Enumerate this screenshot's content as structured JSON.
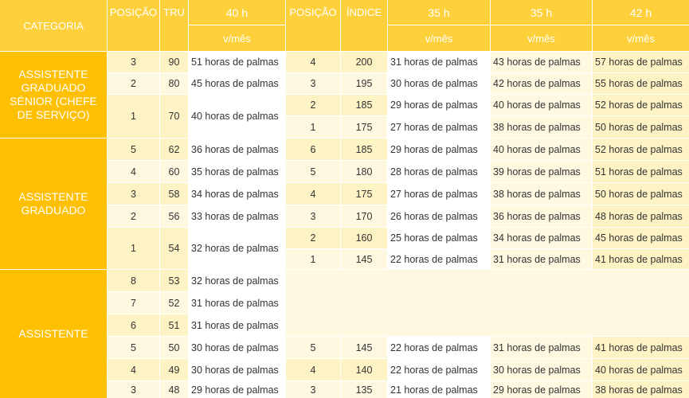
{
  "headers": {
    "categoria": "CATEGORIA",
    "posicao": "POSIÇÃO",
    "tru": "TRU",
    "h40": "40 h",
    "posicao2": "POSIÇÃO",
    "indice": "ÍNDICE",
    "h35a": "35 h",
    "h35b": "35 h",
    "h42": "42 h",
    "sub": "v/mês"
  },
  "categories": [
    {
      "label": "ASSISTENTE GRADUADO SÉNIOR (CHEFE DE SERVIÇO)"
    },
    {
      "label": "ASSISTENTE GRADUADO"
    },
    {
      "label": "ASSISTENTE"
    }
  ],
  "left_rows": [
    {
      "posicao": "3",
      "tru": "90",
      "h40": "51 horas de palmas"
    },
    {
      "posicao": "2",
      "tru": "80",
      "h40": "45 horas de palmas"
    },
    {
      "posicao": "1",
      "tru": "70",
      "h40": "40 horas de palmas"
    },
    {
      "posicao": "5",
      "tru": "62",
      "h40": "36 horas de palmas"
    },
    {
      "posicao": "4",
      "tru": "60",
      "h40": "35 horas de palmas"
    },
    {
      "posicao": "3",
      "tru": "58",
      "h40": "34 horas de palmas"
    },
    {
      "posicao": "2",
      "tru": "56",
      "h40": "33 horas de palmas"
    },
    {
      "posicao": "1",
      "tru": "54",
      "h40": "32 horas de palmas"
    },
    {
      "posicao": "8",
      "tru": "53",
      "h40": "32 horas de palmas"
    },
    {
      "posicao": "7",
      "tru": "52",
      "h40": "31 horas de palmas"
    },
    {
      "posicao": "6",
      "tru": "51",
      "h40": "31 horas de palmas"
    },
    {
      "posicao": "5",
      "tru": "50",
      "h40": "30 horas de palmas"
    },
    {
      "posicao": "4",
      "tru": "49",
      "h40": "30 horas de palmas"
    },
    {
      "posicao": "3",
      "tru": "48",
      "h40": "29 horas de palmas"
    }
  ],
  "right_rows": [
    {
      "posicao": "4",
      "indice": "200",
      "h35a": "31 horas de palmas",
      "h35b": "43 horas de palmas",
      "h42": "57 horas de palmas"
    },
    {
      "posicao": "3",
      "indice": "195",
      "h35a": "30 horas de palmas",
      "h35b": "42 horas de palmas",
      "h42": "55 horas de palmas"
    },
    {
      "posicao": "2",
      "indice": "185",
      "h35a": "29 horas de palmas",
      "h35b": "40 horas de palmas",
      "h42": "52 horas de palmas"
    },
    {
      "posicao": "1",
      "indice": "175",
      "h35a": "27 horas de palmas",
      "h35b": "38 horas de palmas",
      "h42": "50 horas de palmas"
    },
    {
      "posicao": "6",
      "indice": "185",
      "h35a": "29 horas de palmas",
      "h35b": "40 horas de palmas",
      "h42": "52 horas de palmas"
    },
    {
      "posicao": "5",
      "indice": "180",
      "h35a": "28 horas de palmas",
      "h35b": "39 horas de palmas",
      "h42": "51 horas de palmas"
    },
    {
      "posicao": "4",
      "indice": "175",
      "h35a": "27 horas de palmas",
      "h35b": "38 horas de palmas",
      "h42": "50 horas de palmas"
    },
    {
      "posicao": "3",
      "indice": "170",
      "h35a": "26 horas de palmas",
      "h35b": "36 horas de palmas",
      "h42": "48 horas de palmas"
    },
    {
      "posicao": "2",
      "indice": "160",
      "h35a": "25 horas de palmas",
      "h35b": "34 horas de palmas",
      "h42": "45 horas de palmas"
    },
    {
      "posicao": "1",
      "indice": "145",
      "h35a": "22 horas de palmas",
      "h35b": "31 horas de palmas",
      "h42": "41 horas de palmas"
    },
    {
      "posicao": "5",
      "indice": "145",
      "h35a": "22 horas de palmas",
      "h35b": "31 horas de palmas",
      "h42": "41 horas de palmas"
    },
    {
      "posicao": "4",
      "indice": "140",
      "h35a": "22 horas de palmas",
      "h35b": "30 horas de palmas",
      "h42": "40 horas de palmas"
    },
    {
      "posicao": "3",
      "indice": "135",
      "h35a": "21 horas de palmas",
      "h35b": "29 horas de palmas",
      "h42": "38 horas de palmas"
    }
  ],
  "colors": {
    "header": "#fed03b",
    "category": "#fec000",
    "row_dark": "#fef3c4",
    "row_light": "#fef8e0",
    "text": "#333333"
  }
}
